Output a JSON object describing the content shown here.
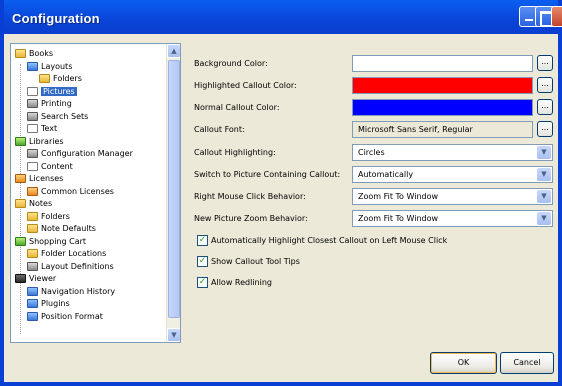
{
  "window": {
    "title": "Configuration"
  },
  "tree": {
    "items": [
      {
        "label": "Books",
        "icon": "folder-icon"
      },
      {
        "label": "Layouts",
        "icon": "layouts-icon"
      },
      {
        "label": "Folders",
        "icon": "folders-icon"
      },
      {
        "label": "Pictures",
        "icon": "pictures-icon",
        "selected": true
      },
      {
        "label": "Printing",
        "icon": "printer-icon"
      },
      {
        "label": "Search Sets",
        "icon": "search-sets-icon"
      },
      {
        "label": "Text",
        "icon": "text-icon"
      },
      {
        "label": "Libraries",
        "icon": "libraries-icon"
      },
      {
        "label": "Configuration Manager",
        "icon": "configuration-manager-icon"
      },
      {
        "label": "Content",
        "icon": "content-icon"
      },
      {
        "label": "Licenses",
        "icon": "licenses-icon"
      },
      {
        "label": "Common Licenses",
        "icon": "key-icon"
      },
      {
        "label": "Notes",
        "icon": "notes-icon"
      },
      {
        "label": "Folders",
        "icon": "folders-icon"
      },
      {
        "label": "Note Defaults",
        "icon": "note-defaults-icon"
      },
      {
        "label": "Shopping Cart",
        "icon": "shopping-cart-icon"
      },
      {
        "label": "Folder Locations",
        "icon": "folders-icon"
      },
      {
        "label": "Layout Definitions",
        "icon": "layout-definitions-icon"
      },
      {
        "label": "Viewer",
        "icon": "viewer-icon"
      },
      {
        "label": "Navigation History",
        "icon": "navigation-history-icon"
      },
      {
        "label": "Plugins",
        "icon": "plugins-icon"
      },
      {
        "label": "Position Format",
        "icon": "position-format-icon"
      }
    ]
  },
  "form": {
    "background_color_label": "Background Color:",
    "highlighted_callout_color_label": "Highlighted Callout Color:",
    "normal_callout_color_label": "Normal Callout Color:",
    "callout_font_label": "Callout Font:",
    "callout_font_value": "Microsoft Sans Serif, Regular",
    "callout_highlighting_label": "Callout Highlighting:",
    "callout_highlighting_value": "Circles",
    "switch_picture_label": "Switch to Picture Containing Callout:",
    "switch_picture_value": "Automatically",
    "right_click_label": "Right Mouse Click Behavior:",
    "right_click_value": "Zoom Fit To Window",
    "new_picture_zoom_label": "New Picture Zoom Behavior:",
    "new_picture_zoom_value": "Zoom Fit To Window",
    "browse_label": "...",
    "colors": {
      "background": "#ffffff",
      "highlighted": "#ff0000",
      "normal": "#0000ff"
    },
    "checks": [
      {
        "label": "Automatically Highlight Closest Callout on Left Mouse Click",
        "checked": true
      },
      {
        "label": "Show Callout Tool Tips",
        "checked": true
      },
      {
        "label": "Allow Redlining",
        "checked": true
      }
    ]
  },
  "buttons": {
    "ok": "OK",
    "cancel": "Cancel"
  }
}
